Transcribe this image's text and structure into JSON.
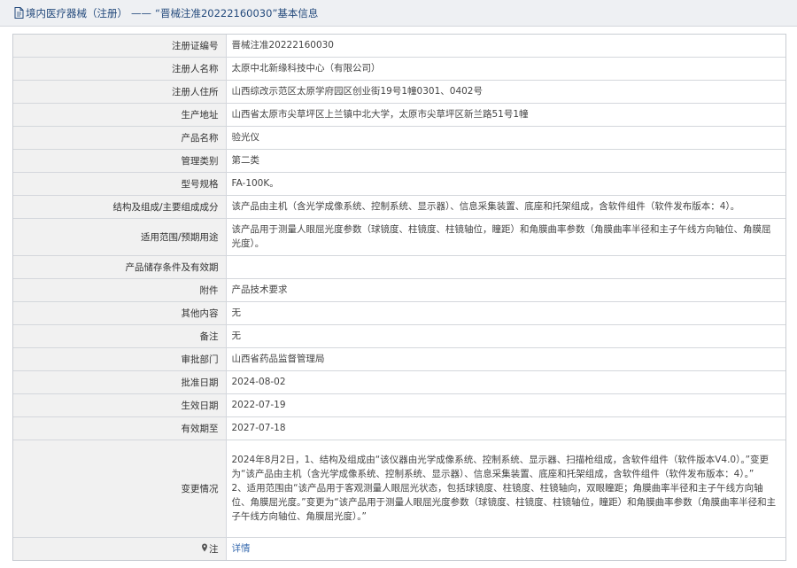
{
  "header": {
    "section": "境内医疗器械（注册）",
    "separator": "——",
    "record_title": "“晋械注准20222160030”基本信息"
  },
  "rows": {
    "reg_no": {
      "label": "注册证编号",
      "value": "晋械注准20222160030"
    },
    "registrant": {
      "label": "注册人名称",
      "value": "太原中北新缘科技中心（有限公司）"
    },
    "address": {
      "label": "注册人住所",
      "value": "山西综改示范区太原学府园区创业街19号1幢0301、0402号"
    },
    "production": {
      "label": "生产地址",
      "value": "山西省太原市尖草坪区上兰镇中北大学，太原市尖草坪区新兰路51号1幢"
    },
    "product_name": {
      "label": "产品名称",
      "value": "验光仪"
    },
    "category": {
      "label": "管理类别",
      "value": "第二类"
    },
    "model": {
      "label": "型号规格",
      "value": "FA-100K。"
    },
    "structure": {
      "label": "结构及组成/主要组成成分",
      "value": "该产品由主机（含光学成像系统、控制系统、显示器）、信息采集装置、底座和托架组成，含软件组件（软件发布版本：4）。"
    },
    "scope": {
      "label": "适用范围/预期用途",
      "value": "该产品用于测量人眼屈光度参数（球镜度、柱镜度、柱镜轴位，瞳距）和角膜曲率参数（角膜曲率半径和主子午线方向轴位、角膜屈光度）。"
    },
    "storage": {
      "label": "产品储存条件及有效期",
      "value": ""
    },
    "attachment": {
      "label": "附件",
      "value": "产品技术要求"
    },
    "other": {
      "label": "其他内容",
      "value": "无"
    },
    "remark": {
      "label": "备注",
      "value": "无"
    },
    "dept": {
      "label": "审批部门",
      "value": "山西省药品监督管理局"
    },
    "approve_date": {
      "label": "批准日期",
      "value": "2024-08-02"
    },
    "effective_date": {
      "label": "生效日期",
      "value": "2022-07-19"
    },
    "expiry_date": {
      "label": "有效期至",
      "value": "2027-07-18"
    },
    "changes": {
      "label": "变更情况",
      "part1": "2024年8月2日，1、结构及组成由“该仪器由光学成像系统、控制系统、显示器、扫描枪组成，含软件组件（软件版本V4.0）。”变更为“该产品由主机（含光学成像系统、控制系统、显示器）、信息采集装置、底座和托架组成，含软件组件（软件发布版本：4）。”",
      "part2": "2、适用范围由“该产品用于客观测量人眼屈光状态，包括球镜度、柱镜度、柱镜轴向，双眼瞳距；角膜曲率半径和主子午线方向轴位、角膜屈光度。”变更为“该产品用于测量人眼屈光度参数（球镜度、柱镜度、柱镜轴位，瞳距）和角膜曲率参数（角膜曲率半径和主子午线方向轴位、角膜屈光度）。”"
    },
    "note": {
      "label": "注",
      "link": "详情"
    }
  },
  "colors": {
    "title": "#244a7c",
    "link": "#3b6db0",
    "label_bg": "#f1f1f1"
  },
  "icons": {
    "title": "document-icon",
    "note": "pin-icon"
  }
}
